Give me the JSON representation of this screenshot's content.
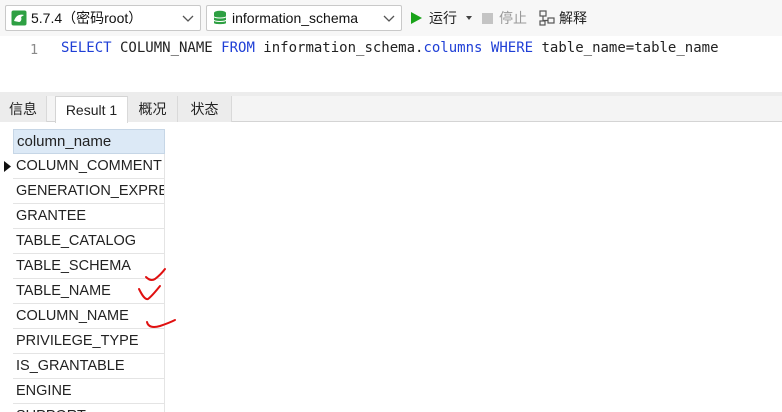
{
  "toolbar": {
    "connection": "5.7.4（密码root）",
    "database": "information_schema",
    "run_label": "运行",
    "stop_label": "停止",
    "explain_label": "解释"
  },
  "editor": {
    "line_number": "1",
    "sql": [
      {
        "t": "SELECT",
        "kw": true
      },
      {
        "t": " COLUMN_NAME ",
        "kw": false
      },
      {
        "t": "FROM",
        "kw": true
      },
      {
        "t": " information_schema.",
        "kw": false
      },
      {
        "t": "columns",
        "kw": true
      },
      {
        "t": " ",
        "kw": false
      },
      {
        "t": "WHERE",
        "kw": true
      },
      {
        "t": " table_name=table_name",
        "kw": false
      }
    ]
  },
  "result_tabs": [
    {
      "label": "信息",
      "active": false
    },
    {
      "label": "Result 1",
      "active": true
    },
    {
      "label": "概况",
      "active": false
    },
    {
      "label": "状态",
      "active": false
    }
  ],
  "grid": {
    "column_header": "column_name",
    "rows": [
      "COLUMN_COMMENT",
      "GENERATION_EXPRESSION",
      "GRANTEE",
      "TABLE_CATALOG",
      "TABLE_SCHEMA",
      "TABLE_NAME",
      "COLUMN_NAME",
      "PRIVILEGE_TYPE",
      "IS_GRANTABLE",
      "ENGINE",
      "SUPPORT"
    ]
  },
  "colors": {
    "keyword": "#1f3fd6",
    "run_green": "#19a319",
    "annotation_red": "#e01010"
  }
}
